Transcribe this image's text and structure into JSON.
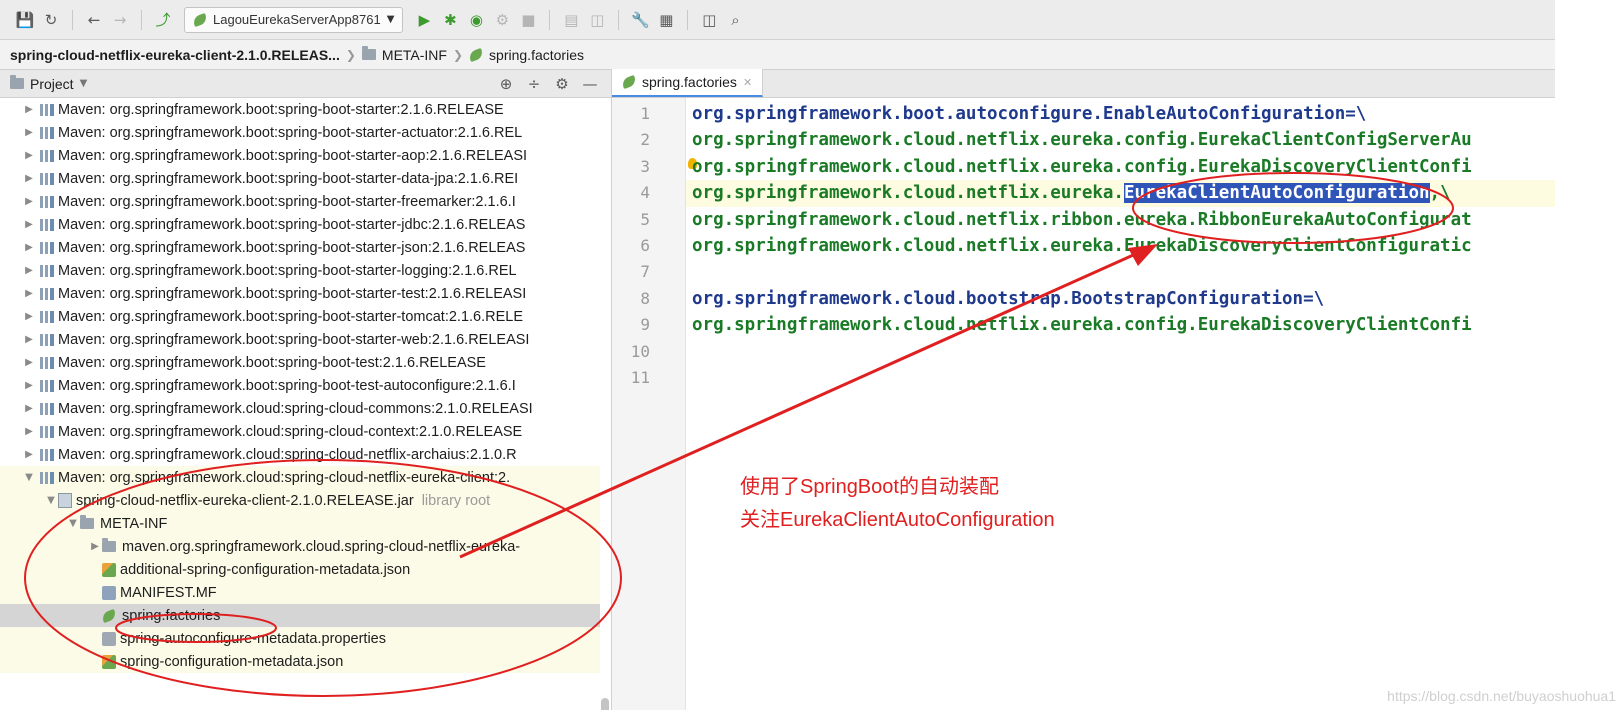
{
  "toolbar": {
    "run_config": "LagouEurekaServerApp8761",
    "icons": [
      "save-icon",
      "sync-icon",
      "back-icon",
      "forward-icon",
      "build-icon",
      "run-icon",
      "debug-icon",
      "coverage-icon",
      "profile-icon",
      "stop-icon",
      "structure-icon",
      "tool-icon",
      "settings-icon",
      "terminal-icon",
      "search-icon"
    ]
  },
  "breadcrumb": {
    "module": "spring-cloud-netflix-eureka-client-2.1.0.RELEAS...",
    "folder": "META-INF",
    "file": "spring.factories"
  },
  "project": {
    "title": "Project",
    "items": [
      {
        "label": "Maven: org.springframework.boot:spring-boot-starter:2.1.6.RELEASE",
        "level": 0,
        "type": "lib"
      },
      {
        "label": "Maven: org.springframework.boot:spring-boot-starter-actuator:2.1.6.REL",
        "level": 0,
        "type": "lib"
      },
      {
        "label": "Maven: org.springframework.boot:spring-boot-starter-aop:2.1.6.RELEASI",
        "level": 0,
        "type": "lib"
      },
      {
        "label": "Maven: org.springframework.boot:spring-boot-starter-data-jpa:2.1.6.REI",
        "level": 0,
        "type": "lib"
      },
      {
        "label": "Maven: org.springframework.boot:spring-boot-starter-freemarker:2.1.6.I",
        "level": 0,
        "type": "lib"
      },
      {
        "label": "Maven: org.springframework.boot:spring-boot-starter-jdbc:2.1.6.RELEAS",
        "level": 0,
        "type": "lib"
      },
      {
        "label": "Maven: org.springframework.boot:spring-boot-starter-json:2.1.6.RELEAS",
        "level": 0,
        "type": "lib"
      },
      {
        "label": "Maven: org.springframework.boot:spring-boot-starter-logging:2.1.6.REL",
        "level": 0,
        "type": "lib"
      },
      {
        "label": "Maven: org.springframework.boot:spring-boot-starter-test:2.1.6.RELEASI",
        "level": 0,
        "type": "lib"
      },
      {
        "label": "Maven: org.springframework.boot:spring-boot-starter-tomcat:2.1.6.RELE",
        "level": 0,
        "type": "lib"
      },
      {
        "label": "Maven: org.springframework.boot:spring-boot-starter-web:2.1.6.RELEASI",
        "level": 0,
        "type": "lib"
      },
      {
        "label": "Maven: org.springframework.boot:spring-boot-test:2.1.6.RELEASE",
        "level": 0,
        "type": "lib"
      },
      {
        "label": "Maven: org.springframework.boot:spring-boot-test-autoconfigure:2.1.6.I",
        "level": 0,
        "type": "lib"
      },
      {
        "label": "Maven: org.springframework.cloud:spring-cloud-commons:2.1.0.RELEASI",
        "level": 0,
        "type": "lib"
      },
      {
        "label": "Maven: org.springframework.cloud:spring-cloud-context:2.1.0.RELEASE",
        "level": 0,
        "type": "lib"
      },
      {
        "label": "Maven: org.springframework.cloud:spring-cloud-netflix-archaius:2.1.0.R",
        "level": 0,
        "type": "lib"
      },
      {
        "label": "Maven: org.springframework.cloud:spring-cloud-netflix-eureka-client:2.",
        "level": 0,
        "type": "lib",
        "expanded": true
      },
      {
        "label": "spring-cloud-netflix-eureka-client-2.1.0.RELEASE.jar",
        "suffix": "library root",
        "level": 1,
        "type": "jar",
        "expanded": true
      },
      {
        "label": "META-INF",
        "level": 2,
        "type": "folder",
        "expanded": true
      },
      {
        "label": "maven.org.springframework.cloud.spring-cloud-netflix-eureka-",
        "level": 3,
        "type": "folder",
        "collapsed": true
      },
      {
        "label": "additional-spring-configuration-metadata.json",
        "level": 3,
        "type": "json"
      },
      {
        "label": "MANIFEST.MF",
        "level": 3,
        "type": "mf"
      },
      {
        "label": "spring.factories",
        "level": 3,
        "type": "factories",
        "selected": true
      },
      {
        "label": "spring-autoconfigure-metadata.properties",
        "level": 3,
        "type": "props"
      },
      {
        "label": "spring-configuration-metadata.json",
        "level": 3,
        "type": "json"
      }
    ]
  },
  "editor": {
    "tab": "spring.factories",
    "lines": [
      {
        "n": "1",
        "text": "org.springframework.boot.autoconfigure.EnableAutoConfiguration=\\",
        "kind": "key"
      },
      {
        "n": "2",
        "text": "org.springframework.cloud.netflix.eureka.config.EurekaClientConfigServerAu",
        "kind": "val"
      },
      {
        "n": "3",
        "text": "org.springframework.cloud.netflix.eureka.config.EurekaDiscoveryClientConfi",
        "kind": "val"
      },
      {
        "n": "4",
        "pre": "org.springframework.cloud.netflix.eureka.",
        "hl": "EurekaClientAutoConfiguration",
        "post": ",\\",
        "kind": "val"
      },
      {
        "n": "5",
        "text": "org.springframework.cloud.netflix.ribbon.eureka.RibbonEurekaAutoConfigurat",
        "kind": "val"
      },
      {
        "n": "6",
        "text": "org.springframework.cloud.netflix.eureka.EurekaDiscoveryClientConfiguratic",
        "kind": "val"
      },
      {
        "n": "7",
        "text": "",
        "kind": "val"
      },
      {
        "n": "8",
        "text": "org.springframework.cloud.bootstrap.BootstrapConfiguration=\\",
        "kind": "key"
      },
      {
        "n": "9",
        "text": "org.springframework.cloud.netflix.eureka.config.EurekaDiscoveryClientConfi",
        "kind": "val"
      },
      {
        "n": "10",
        "text": "",
        "kind": "val"
      },
      {
        "n": "11",
        "text": "",
        "kind": "val"
      }
    ]
  },
  "annotation": {
    "line1": "使用了SpringBoot的自动装配",
    "line2": "关注EurekaClientAutoConfiguration",
    "color": "#e02020"
  },
  "watermark": "https://blog.csdn.net/buyaoshuohua1"
}
